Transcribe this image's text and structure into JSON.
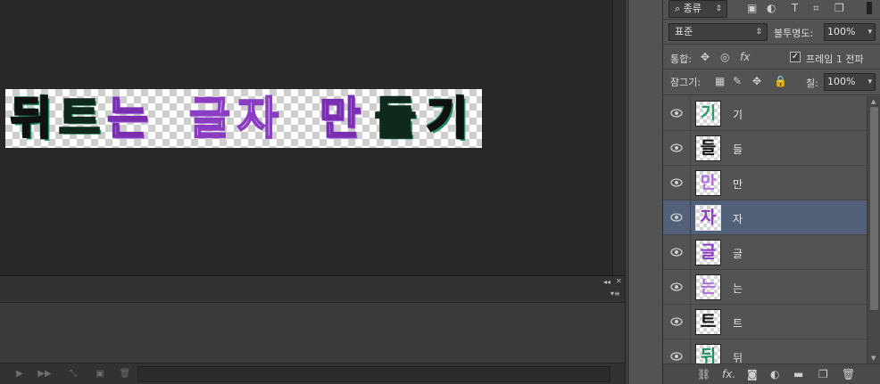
{
  "document": {
    "glyphs": [
      "뒤",
      "트",
      "는",
      "글",
      "자",
      "만",
      "들",
      "기"
    ]
  },
  "layers_panel": {
    "filter_kind": "종류",
    "blend_mode": "표준",
    "opacity_label": "불투명도:",
    "opacity_value": "100%",
    "unify_label": "통합:",
    "propagate_frame_label": "프레임 1 전파",
    "lock_label": "잠그기:",
    "fill_label": "칠:",
    "fill_value": "100%",
    "layers": [
      {
        "name": "기",
        "active": false
      },
      {
        "name": "들",
        "active": false
      },
      {
        "name": "만",
        "active": false
      },
      {
        "name": "자",
        "active": true
      },
      {
        "name": "글",
        "active": false
      },
      {
        "name": "는",
        "active": false
      },
      {
        "name": "트",
        "active": false
      },
      {
        "name": "뒤",
        "active": false
      }
    ]
  },
  "colors": {
    "panel_bg": "#535353",
    "selected_layer": "#52607a",
    "canvas_bg": "#282828",
    "purple_text": "#8a3cc2",
    "green_outline": "#1f8f5f"
  }
}
